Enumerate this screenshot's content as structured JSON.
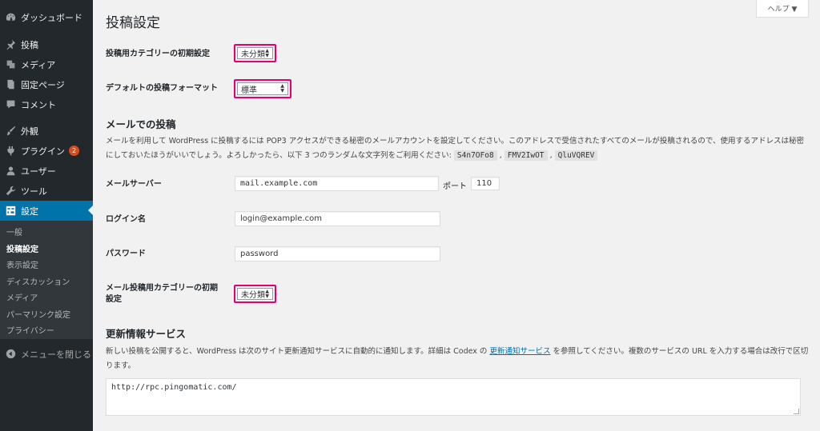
{
  "sidebar": {
    "items": [
      {
        "label": "ダッシュボード",
        "icon": "dashboard-icon"
      },
      {
        "label": "投稿",
        "icon": "pin-icon"
      },
      {
        "label": "メディア",
        "icon": "media-icon"
      },
      {
        "label": "固定ページ",
        "icon": "page-icon"
      },
      {
        "label": "コメント",
        "icon": "comment-icon"
      },
      {
        "label": "外観",
        "icon": "brush-icon"
      },
      {
        "label": "プラグイン",
        "icon": "plugin-icon",
        "badge": "2"
      },
      {
        "label": "ユーザー",
        "icon": "user-icon"
      },
      {
        "label": "ツール",
        "icon": "wrench-icon"
      },
      {
        "label": "設定",
        "icon": "settings-icon"
      }
    ],
    "submenu": [
      "一般",
      "投稿設定",
      "表示設定",
      "ディスカッション",
      "メディア",
      "パーマリンク設定",
      "プライバシー"
    ],
    "collapse_label": "メニューを閉じる"
  },
  "help_tab": "ヘルプ ▼",
  "page_title": "投稿設定",
  "default_category": {
    "label": "投稿用カテゴリーの初期設定",
    "value": "未分類"
  },
  "default_format": {
    "label": "デフォルトの投稿フォーマット",
    "value": "標準"
  },
  "post_via_email": {
    "heading": "メールでの投稿",
    "desc_1": "メールを利用して WordPress に投稿するには POP3 アクセスができる秘密のメールアカウントを設定してください。このアドレスで受信されたすべてのメールが投稿されるので、使用するアドレスは秘密",
    "desc_2": "にしておいたほうがいいでしょう。よろしかったら、以下 3 つのランダムな文字列をご利用ください:",
    "codes": [
      "S4n7OFo8",
      "FMV2IwOT",
      "QluVQREV"
    ],
    "separator": ",",
    "server_label": "メールサーバー",
    "server_value": "mail.example.com",
    "port_label": "ポート",
    "port_value": "110",
    "login_label": "ログイン名",
    "login_value": "login@example.com",
    "password_label": "パスワード",
    "password_value": "password",
    "category_label_1": "メール投稿用カテゴリーの初期",
    "category_label_2": "設定",
    "category_value": "未分類"
  },
  "update_services": {
    "heading": "更新情報サービス",
    "desc_a": "新しい投稿を公開すると、WordPress は次のサイト更新通知サービスに自動的に通知します。詳細は Codex の ",
    "link": "更新通知サービス",
    "desc_b": " を参照してください。複数のサービスの URL を入力する場合は改行で区切",
    "desc_c": "ります。",
    "textarea_value": "http://rpc.pingomatic.com/"
  },
  "colors": {
    "sidebar_bg": "#23282d",
    "active": "#0073aa",
    "highlight": "#e6006e",
    "badge": "#d54e21"
  }
}
